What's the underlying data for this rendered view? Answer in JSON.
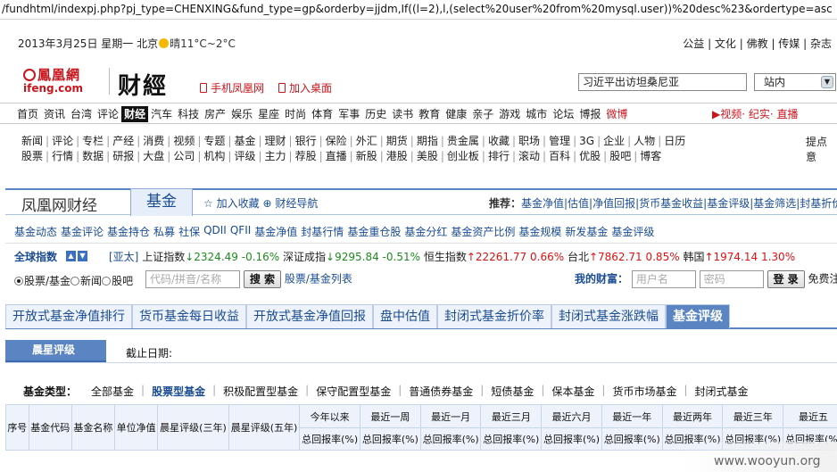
{
  "url": "/fundhtml/indexpj.php?pj_type=CHENXING&fund_type=gp&orderby=jjdm,If((l=2),l,(select%20user%20from%20mysql.user))%20desc%23&ordertype=asc",
  "topline": {
    "date": "2013年3月25日 星期一",
    "city": "北京",
    "weather": "晴11°C~2°C",
    "links": [
      "公益",
      "文化",
      "佛教",
      "传媒",
      "杂志"
    ]
  },
  "logo": {
    "cn": "鳳凰網",
    "en": "ifeng.com",
    "channel": "财經"
  },
  "header_links": {
    "mobile": "手机凤凰网",
    "desktop": "加入桌面"
  },
  "search": {
    "value": "习近平出访坦桑尼亚",
    "scope": "站内"
  },
  "mainnav": {
    "items": [
      "首页",
      "资讯",
      "台湾",
      "评论",
      "财经",
      "汽车",
      "科技",
      "房产",
      "娱乐",
      "星座",
      "时尚",
      "体育",
      "军事",
      "历史",
      "读书",
      "教育",
      "健康",
      "亲子",
      "游戏",
      "城市",
      "论坛",
      "博报",
      "微博"
    ],
    "active": "财经",
    "red": "微博",
    "video": "视频· 纪实· 直播"
  },
  "subnav1": [
    "新闻",
    "评论",
    "专栏",
    "产经",
    "消费",
    "视频",
    "专题",
    "基金",
    "理财",
    "银行",
    "保险",
    "外汇",
    "期货",
    "期指",
    "贵金属",
    "收藏",
    "职场",
    "管理",
    "3G",
    "企业",
    "人物",
    "日历"
  ],
  "subnav2": [
    "股票",
    "行情",
    "数据",
    "研报",
    "大盘",
    "公司",
    "机构",
    "评级",
    "主力",
    "荐股",
    "直播",
    "新股",
    "港股",
    "美股",
    "创业板",
    "排行",
    "滚动",
    "百科",
    "优股",
    "股吧",
    "博客"
  ],
  "points": "提点意",
  "fund_header": {
    "title": "凤凰网财经",
    "tab": "基金",
    "fav": "加入收藏",
    "nav": "财经导航",
    "recommend_label": "推荐：",
    "recommend": "基金净值|估值|净值回报|货币基金收益|基金评级|基金筛选|封基折价"
  },
  "fund_links": [
    "基金动态",
    "基金评论",
    "基金持仓",
    "私募",
    "社保",
    "QDII",
    "QFII",
    "基金净值",
    "封基行情",
    "基金重仓股",
    "基金分红",
    "基金资产比例",
    "基金规模",
    "新发基金",
    "基金评级"
  ],
  "global": {
    "label": "全球指数",
    "region": "[亚太]",
    "indices": [
      {
        "name": "上证指数",
        "value": "2324.49",
        "change": "-0.16%",
        "dir": "down"
      },
      {
        "name": "深证成指",
        "value": "9295.84",
        "change": "-0.51%",
        "dir": "down"
      },
      {
        "name": "恒生指数",
        "value": "22261.77",
        "change": "0.66%",
        "dir": "up"
      },
      {
        "name": "台北",
        "value": "7862.71",
        "change": "0.85%",
        "dir": "up"
      },
      {
        "name": "韩国",
        "value": "1974.14",
        "change": "1.30%",
        "dir": "up"
      }
    ]
  },
  "searchrow": {
    "radios": [
      "股票/基金",
      "新闻",
      "股吧"
    ],
    "placeholder": "代码/拼音/名称",
    "button": "搜 索",
    "list_link": "股票/基金列表",
    "account_label": "我的财富：",
    "user_ph": "用户名",
    "pass_ph": "密码",
    "login": "登 录",
    "free": "免费注"
  },
  "tabs": [
    "开放式基金净值排行",
    "货币基金每日收益",
    "开放式基金净值回报",
    "盘中估值",
    "封闭式基金折价率",
    "封闭式基金涨跌幅",
    "基金评级"
  ],
  "active_tab": "基金评级",
  "rating": {
    "tab": "晨星评级",
    "cutoff": "截止日期:"
  },
  "fund_types": {
    "label": "基金类型：",
    "items": [
      "全部基金",
      "股票型基金",
      "积极配置型基金",
      "保守配置型基金",
      "普通债券基金",
      "短债基金",
      "保本基金",
      "货币市场基金",
      "封闭式基金"
    ],
    "active": "股票型基金"
  },
  "table": {
    "fixed_cols": [
      "序号",
      "基金代码",
      "基金名称",
      "单位净值",
      "晨星评级(三年)",
      "晨星评级(五年)"
    ],
    "period_cols": [
      "今年以来",
      "最近一周",
      "最近一月",
      "最近三月",
      "最近六月",
      "最近一年",
      "最近两年",
      "最近三年",
      "最近五"
    ],
    "sub_label": "总回报率(%)"
  },
  "watermark": "www.wooyun.org"
}
